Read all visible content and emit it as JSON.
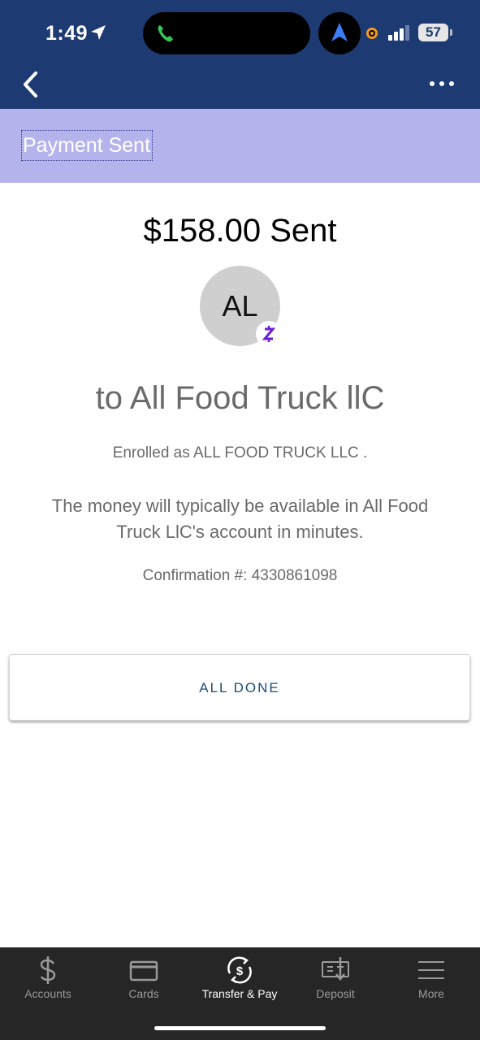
{
  "status_bar": {
    "time": "1:49",
    "battery": "57"
  },
  "header": {
    "title": "Payment Sent"
  },
  "payment": {
    "amount_sent": "$158.00 Sent",
    "avatar_initials": "AL",
    "zelle_badge": "Z",
    "recipient": "to All Food Truck llC",
    "enrolled": "Enrolled as ALL FOOD TRUCK LLC .",
    "availability": "The money will typically be available in All Food Truck LlC's account in minutes.",
    "confirmation": "Confirmation #: 4330861098"
  },
  "actions": {
    "done_label": "ALL DONE"
  },
  "tabs": [
    {
      "label": "Accounts",
      "icon": "dollar-icon"
    },
    {
      "label": "Cards",
      "icon": "card-icon"
    },
    {
      "label": "Transfer & Pay",
      "icon": "transfer-icon",
      "active": true
    },
    {
      "label": "Deposit",
      "icon": "deposit-check-icon"
    },
    {
      "label": "More",
      "icon": "menu-icon"
    }
  ],
  "colors": {
    "header_bar": "#1d3b72",
    "page_header": "#b5b3ec",
    "tab_bar": "#262626",
    "zelle": "#6d1ed4"
  }
}
